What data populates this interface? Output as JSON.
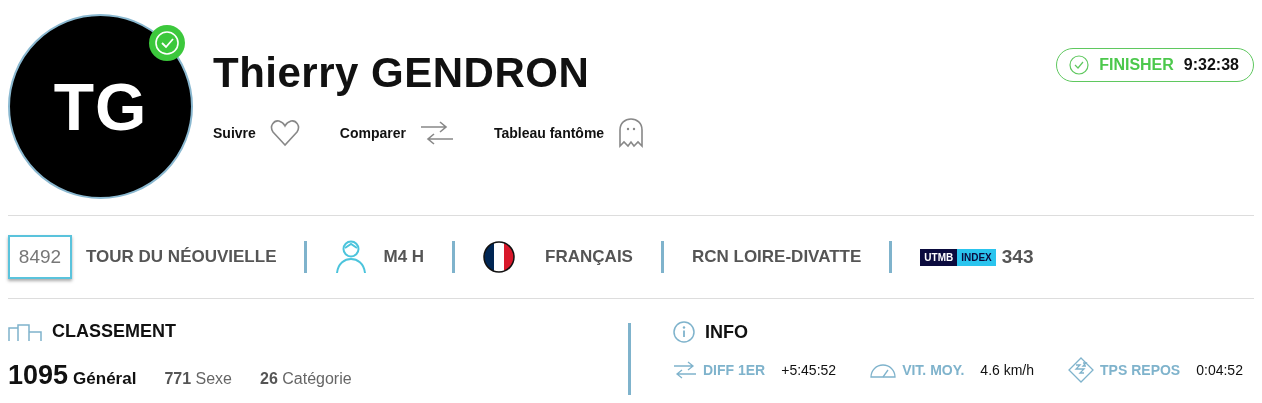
{
  "runner": {
    "initials": "TG",
    "name": "Thierry GENDRON",
    "verified": true
  },
  "actions": [
    {
      "kind": "heart",
      "label": "Suivre"
    },
    {
      "kind": "arrows",
      "label": "Comparer"
    },
    {
      "kind": "ghost",
      "label": "Tableau fantôme"
    }
  ],
  "status": {
    "label": "FINISHER",
    "time": "9:32:38"
  },
  "details": [
    {
      "kind": "bib",
      "text": "8492"
    },
    {
      "kind": "race",
      "text": "TOUR DU NÉOUVIELLE"
    },
    {
      "kind": "category",
      "text": "M4 H"
    },
    {
      "kind": "nationality",
      "text": "FRANÇAIS"
    },
    {
      "kind": "club",
      "text": "RCN LOIRE-DIVATTE"
    },
    {
      "kind": "index",
      "badge_left": "UTMB",
      "badge_right": "INDEX",
      "text": "343"
    }
  ],
  "ranking": {
    "title": "CLASSEMENT",
    "items": [
      {
        "kind": "main",
        "value": "1095",
        "label": "Général"
      },
      {
        "kind": "minor",
        "text": "**771** Sexe"
      },
      {
        "kind": "minor",
        "text": "**26** Catégorie"
      }
    ]
  },
  "info": {
    "title": "INFO",
    "items": [
      {
        "kind": "diff",
        "label": "DIFF 1ER",
        "value": "+5:45:52"
      },
      {
        "kind": "speed",
        "label": "VIT. MOY.",
        "value": "4.6 km/h"
      },
      {
        "kind": "rest",
        "label": "TPS REPOS",
        "value": "0:04:52"
      }
    ]
  }
}
